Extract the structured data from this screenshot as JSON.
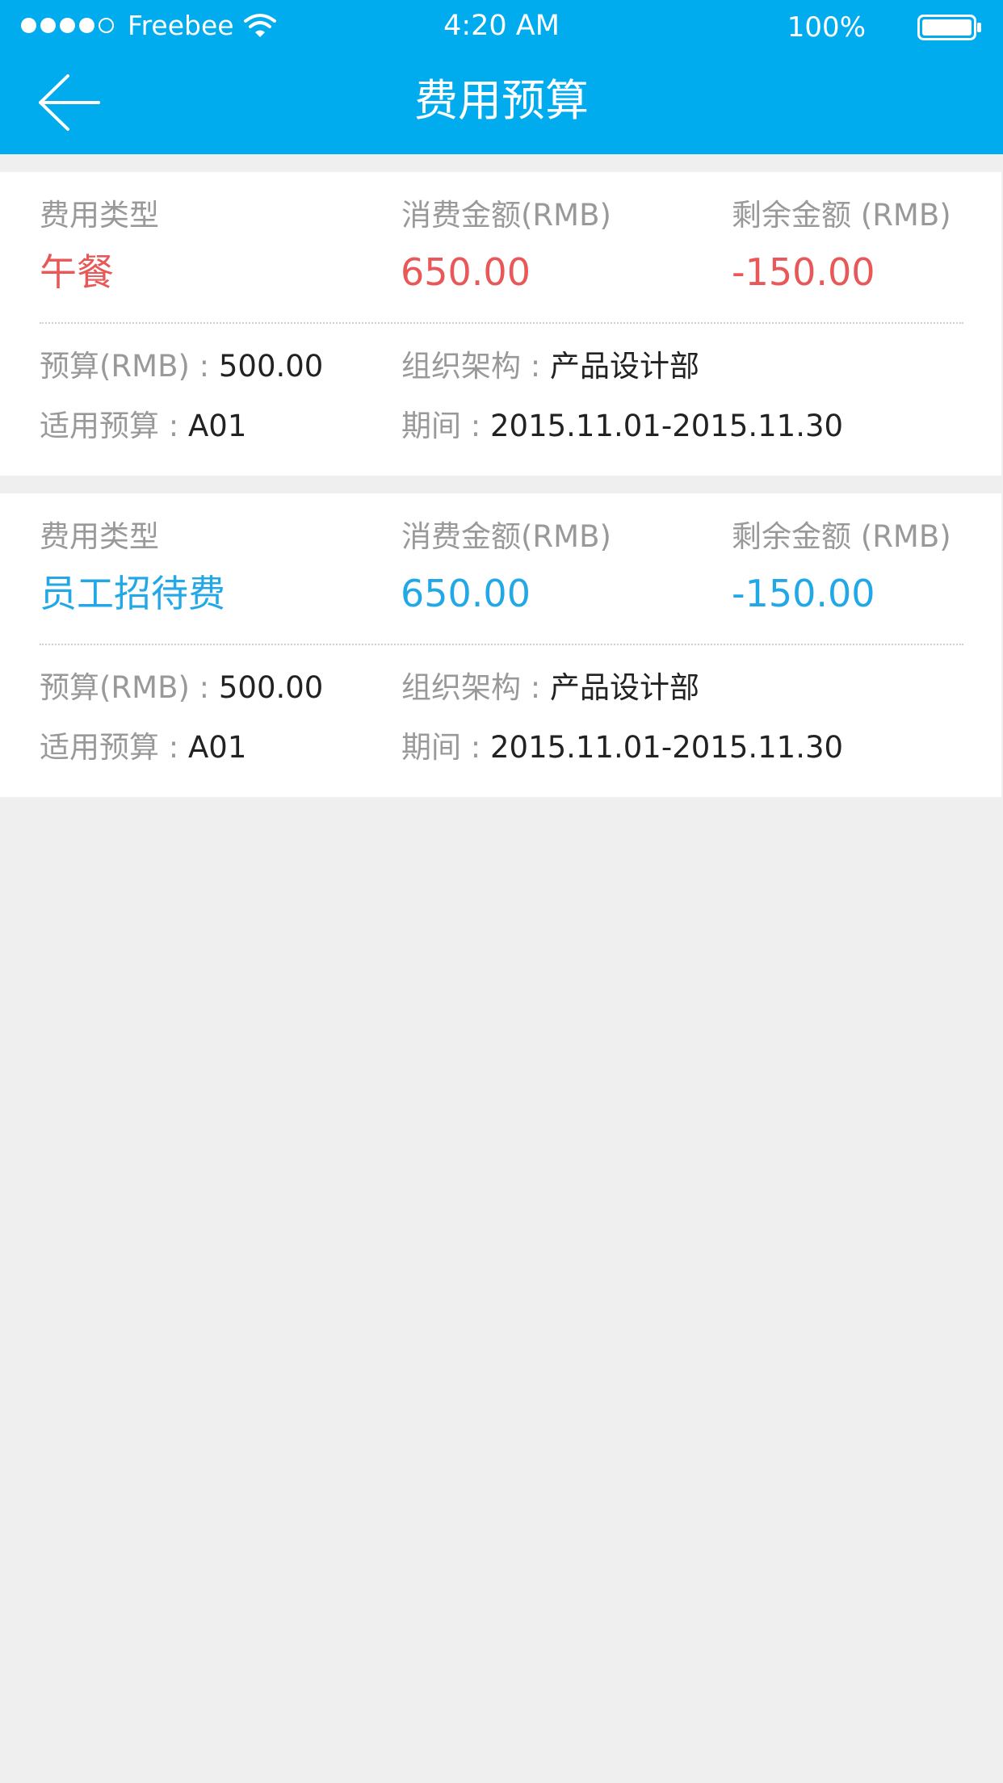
{
  "status_bar": {
    "carrier": "Freebee",
    "time": "4:20 AM",
    "battery": "100%"
  },
  "nav": {
    "title": "费用预算"
  },
  "records": [
    {
      "type_label": "费用类型",
      "type_value": "午餐",
      "spent_label": "消费金额(RMB)",
      "spent_value": "650.00",
      "remaining_label": "剩余金额 (RMB)",
      "remaining_value": "-150.00",
      "budget_label": "预算(RMB) : ",
      "budget_value": "500.00",
      "org_label": "组织架构 : ",
      "org_value": "产品设计部",
      "applicable_label": "适用预算 : ",
      "applicable_value": "A01",
      "period_label": "期间 : ",
      "period_value": "2015.11.01-2015.11.30",
      "accent": "#e85858"
    },
    {
      "type_label": "费用类型",
      "type_value": "员工招待费",
      "spent_label": "消费金额(RMB)",
      "spent_value": "650.00",
      "remaining_label": "剩余金额 (RMB)",
      "remaining_value": "-150.00",
      "budget_label": "预算(RMB) : ",
      "budget_value": "500.00",
      "org_label": "组织架构 : ",
      "org_value": "产品设计部",
      "applicable_label": "适用预算 : ",
      "applicable_value": "A01",
      "period_label": "期间 : ",
      "period_value": "2015.11.01-2015.11.30",
      "accent": "#22a8e6"
    }
  ],
  "colors": {
    "header_bg": "#00aced",
    "page_bg": "#efefef",
    "label_gray": "#999999"
  },
  "icons": [
    "signal-dots-icon",
    "wifi-icon",
    "battery-icon",
    "back-arrow-icon"
  ]
}
